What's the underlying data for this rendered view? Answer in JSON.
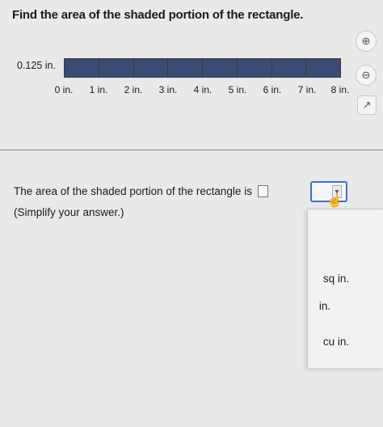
{
  "question": {
    "text": "Find the area of the shaded portion of the rectangle."
  },
  "figure": {
    "height_label": "0.125 in.",
    "segments_total": 8,
    "segments_shaded": 8,
    "shade_color": "#3c4b73",
    "ticks": [
      "0 in.",
      "1 in.",
      "2 in.",
      "3 in.",
      "4 in.",
      "5 in.",
      "6 in.",
      "7 in.",
      "8 in."
    ]
  },
  "answer": {
    "prompt": "The area of the shaded portion of the rectangle is",
    "value": "",
    "simplify_note": "(Simplify your answer.)"
  },
  "unit_dropdown": {
    "options": [
      "sq in.",
      "in.",
      "cu in."
    ],
    "accent_color": "#3d6fd6"
  },
  "icons": [
    "zoom-in-icon",
    "zoom-out-icon",
    "popout-icon",
    "cursor-icon"
  ]
}
